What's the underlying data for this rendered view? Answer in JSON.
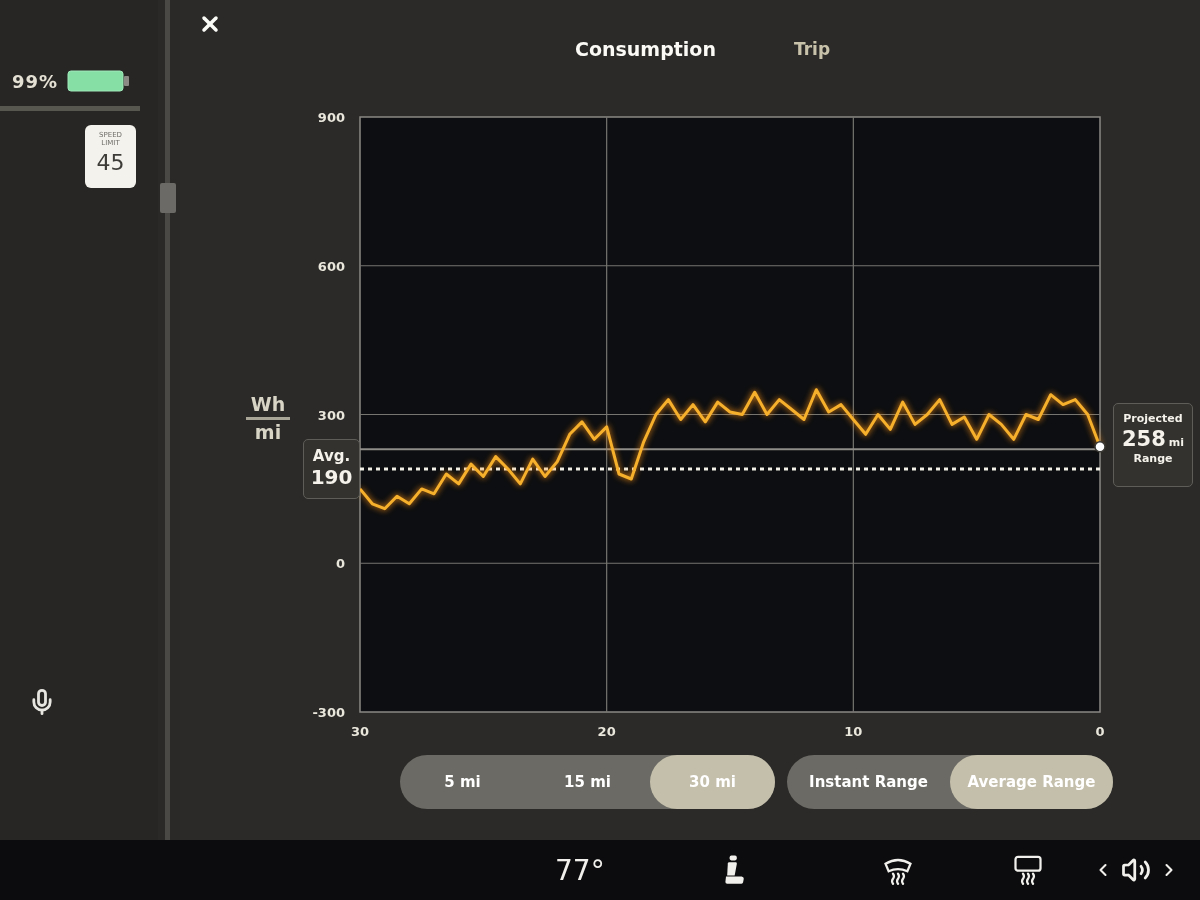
{
  "left_panel": {
    "battery_percent": "99%",
    "speed_limit": {
      "caption": "SPEED LIMIT",
      "value": "45"
    }
  },
  "tabs": [
    {
      "label": "Consumption",
      "selected": true
    },
    {
      "label": "Trip",
      "selected": false
    }
  ],
  "chart": {
    "unit": {
      "numerator": "Wh",
      "denominator": "mi"
    },
    "average": {
      "value": "190"
    },
    "projected": {
      "label": "Projected",
      "value": "258",
      "unit": "mi",
      "caption": "Range"
    },
    "chart_data": {
      "type": "line",
      "x": [
        30,
        29.5,
        29,
        28.5,
        28,
        27.5,
        27,
        26.5,
        26,
        25.5,
        25,
        24.5,
        24,
        23.5,
        23,
        22.5,
        22,
        21.5,
        21,
        20.5,
        20,
        19.5,
        19,
        18.5,
        18,
        17.5,
        17,
        16.5,
        16,
        15.5,
        15,
        14.5,
        14,
        13.5,
        13,
        12.5,
        12,
        11.5,
        11,
        10.5,
        10,
        9.5,
        9,
        8.5,
        8,
        7.5,
        7,
        6.5,
        6,
        5.5,
        5,
        4.5,
        4,
        3.5,
        3,
        2.5,
        2,
        1.5,
        1,
        0.5,
        0
      ],
      "series": [
        {
          "color": "#f7b02c",
          "values": [
            150,
            120,
            110,
            135,
            120,
            150,
            140,
            180,
            160,
            200,
            175,
            215,
            190,
            160,
            210,
            175,
            205,
            260,
            285,
            250,
            275,
            180,
            170,
            245,
            300,
            330,
            290,
            320,
            285,
            325,
            305,
            300,
            345,
            300,
            330,
            310,
            290,
            350,
            305,
            320,
            290,
            260,
            300,
            270,
            325,
            280,
            300,
            330,
            280,
            295,
            250,
            300,
            280,
            250,
            300,
            290,
            340,
            320,
            330,
            300,
            235
          ]
        }
      ],
      "xlim": [
        30,
        0
      ],
      "ylim": [
        -300,
        900
      ],
      "xticks": [
        30,
        20,
        10,
        0
      ],
      "yticks": [
        900,
        600,
        300,
        0,
        -300
      ],
      "grid": true,
      "ref_lines": [
        {
          "axis": "y",
          "value": 230
        },
        {
          "axis": "y",
          "value": 190,
          "label": "Avg."
        }
      ]
    }
  },
  "distance_options": [
    {
      "label": "5 mi",
      "selected": false
    },
    {
      "label": "15 mi",
      "selected": false
    },
    {
      "label": "30 mi",
      "selected": true
    }
  ],
  "range_modes": [
    {
      "label": "Instant Range",
      "selected": false
    },
    {
      "label": "Average Range",
      "selected": true
    }
  ],
  "bottom_bar": {
    "temperature": "77°"
  }
}
